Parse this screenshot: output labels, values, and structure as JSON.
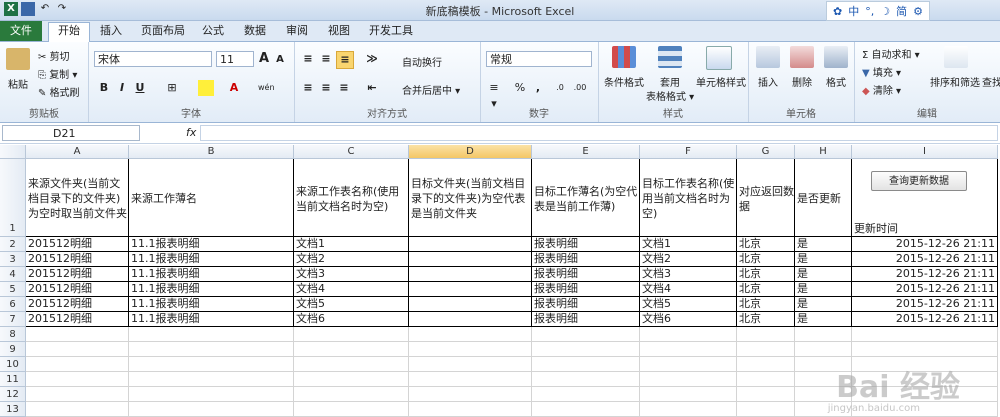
{
  "window": {
    "title": "新底稿模板 - Microsoft Excel"
  },
  "ime": [
    "中",
    "°,",
    "☽",
    "简",
    "⚙"
  ],
  "tabs": [
    "文件",
    "开始",
    "插入",
    "页面布局",
    "公式",
    "数据",
    "审阅",
    "视图",
    "开发工具"
  ],
  "ribbon": {
    "clipboard": {
      "paste": "粘贴",
      "cut": "剪切",
      "copy": "复制 ▾",
      "format_painter": "格式刷",
      "label": "剪贴板"
    },
    "font": {
      "name": "宋体",
      "size": "11",
      "grow": "A",
      "shrink": "A",
      "bold": "B",
      "italic": "I",
      "underline": "U",
      "label": "字体",
      "wen": "wén"
    },
    "alignment": {
      "wrap": "自动换行",
      "merge": "合并后居中 ▾",
      "label": "对齐方式"
    },
    "number": {
      "format": "常规",
      "percent": "%",
      "comma": ",",
      "label": "数字",
      "currency": "≡ ▾",
      "inc_decimal": ".0",
      "dec_decimal": ".00"
    },
    "styles": {
      "cond": "条件格式",
      "table": "套用",
      "table2": "表格格式 ▾",
      "cell": "单元格样式",
      "label": "样式"
    },
    "cells": {
      "insert": "插入",
      "delete": "删除",
      "format": "格式",
      "label": "单元格"
    },
    "editing": {
      "autosum": "Σ 自动求和 ▾",
      "fill": "填充 ▾",
      "clear": "清除 ▾",
      "sort": "排序和筛选",
      "find": "查找",
      "label": "编辑"
    }
  },
  "formula_bar": {
    "name_box": "D21",
    "fx": "fx"
  },
  "columns": [
    "A",
    "B",
    "C",
    "D",
    "E",
    "F",
    "G",
    "H",
    "I"
  ],
  "header_row": [
    "来源文件夹(当前文档目录下的文件夹)为空时取当前文件夹",
    "来源工作薄名",
    "来源工作表名称(使用当前文档名时为空)",
    "目标文件夹(当前文档目录下的文件夹)为空代表是当前文件夹",
    "目标工作薄名(为空代表是当前工作薄)",
    "目标工作表名称(使用当前文档名时为空)",
    "对应返回数据",
    "是否更新",
    "更新时间"
  ],
  "query_button": "查询更新数据",
  "rows": [
    [
      "201512明细",
      "11.1报表明细",
      "文档1",
      "",
      "报表明细",
      "文档1",
      "北京",
      "是",
      "2015-12-26 21:11"
    ],
    [
      "201512明细",
      "11.1报表明细",
      "文档2",
      "",
      "报表明细",
      "文档2",
      "北京",
      "是",
      "2015-12-26 21:11"
    ],
    [
      "201512明细",
      "11.1报表明细",
      "文档3",
      "",
      "报表明细",
      "文档3",
      "北京",
      "是",
      "2015-12-26 21:11"
    ],
    [
      "201512明细",
      "11.1报表明细",
      "文档4",
      "",
      "报表明细",
      "文档4",
      "北京",
      "是",
      "2015-12-26 21:11"
    ],
    [
      "201512明细",
      "11.1报表明细",
      "文档5",
      "",
      "报表明细",
      "文档5",
      "北京",
      "是",
      "2015-12-26 21:11"
    ],
    [
      "201512明细",
      "11.1报表明细",
      "文档6",
      "",
      "报表明细",
      "文档6",
      "北京",
      "是",
      "2015-12-26 21:11"
    ]
  ],
  "row_numbers": [
    "1",
    "2",
    "3",
    "4",
    "5",
    "6",
    "7",
    "8",
    "9",
    "10",
    "11",
    "12",
    "13"
  ],
  "watermark": {
    "main": "Bai 经验",
    "sub": "jingyan.baidu.com"
  }
}
